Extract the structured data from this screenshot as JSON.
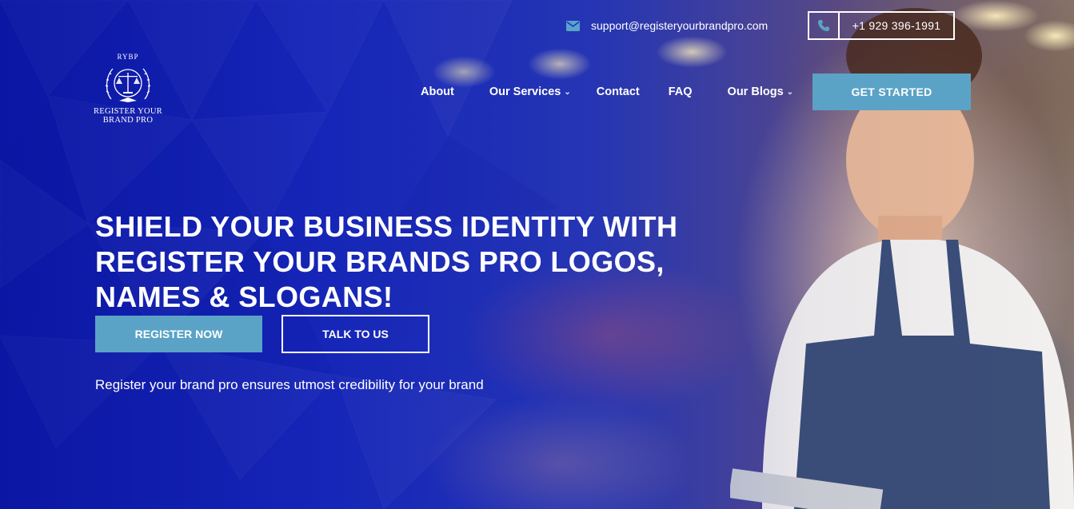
{
  "contact": {
    "email": "support@registeryourbrandpro.com",
    "phone": "+1 929 396-1991",
    "email_icon": "mail-icon",
    "phone_icon": "phone-icon"
  },
  "logo": {
    "abbr": "RYBP",
    "line1": "REGISTER YOUR",
    "line2": "BRAND PRO"
  },
  "nav": {
    "items": [
      {
        "label": "About"
      },
      {
        "label": "Our Services",
        "has_dropdown": true
      },
      {
        "label": "Contact"
      },
      {
        "label": "FAQ"
      },
      {
        "label": "Our Blogs",
        "has_dropdown": true
      }
    ],
    "cta_label": "GET STARTED"
  },
  "hero": {
    "title_line1": "SHIELD YOUR BUSINESS IDENTITY WITH",
    "title_line2": "REGISTER YOUR BRANDS PRO LOGOS,",
    "title_line3": "NAMES & SLOGANS!",
    "primary_button": "REGISTER NOW",
    "secondary_button": "TALK TO US",
    "tagline": "Register your brand pro ensures utmost credibility for your brand"
  },
  "colors": {
    "accent": "#5aa3c6",
    "overlay": "#1a2cc4",
    "text": "#ffffff"
  }
}
